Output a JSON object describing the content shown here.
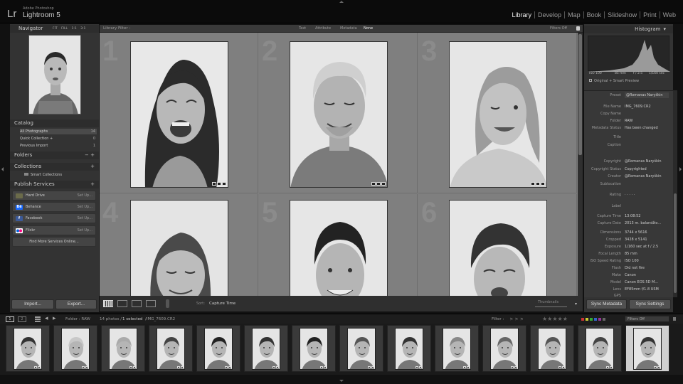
{
  "app": {
    "vendor": "Adobe Photoshop",
    "title": "Lightroom 5",
    "logo": "Lr"
  },
  "modules": [
    {
      "label": "Library",
      "active": true
    },
    {
      "label": "Develop"
    },
    {
      "label": "Map"
    },
    {
      "label": "Book"
    },
    {
      "label": "Slideshow"
    },
    {
      "label": "Print"
    },
    {
      "label": "Web"
    }
  ],
  "left": {
    "navigator": {
      "title": "Navigator",
      "zoom": [
        "FIT",
        "FILL",
        "1:1",
        "3:1"
      ]
    },
    "catalog": {
      "title": "Catalog",
      "items": [
        {
          "label": "All Photographs",
          "count": "14"
        },
        {
          "label": "Quick Collection +",
          "count": "0"
        },
        {
          "label": "Previous Import",
          "count": "1"
        }
      ]
    },
    "folders": {
      "title": "Folders"
    },
    "collections": {
      "title": "Collections",
      "items": [
        "Smart Collections"
      ]
    },
    "publish": {
      "title": "Publish Services",
      "items": [
        {
          "label": "Hard Drive",
          "action": "Set Up...",
          "color": "#6b6b4a"
        },
        {
          "label": "Behance",
          "action": "Set Up...",
          "color": "#1769ff",
          "icon_text": "Bē"
        },
        {
          "label": "Facebook",
          "action": "Set Up...",
          "color": "#3b5998",
          "icon_text": "f"
        },
        {
          "label": "Flickr",
          "action": "Set Up...",
          "color": "#ffffff"
        }
      ],
      "find_more": "Find More Services Online..."
    },
    "import_label": "Import...",
    "export_label": "Export..."
  },
  "filter_bar": {
    "title": "Library Filter :",
    "options": [
      "Text",
      "Attribute",
      "Metadata",
      "None"
    ],
    "active": "None",
    "status": "Filters Off"
  },
  "grid": {
    "cells": [
      "1",
      "2",
      "3",
      "4",
      "5",
      "6"
    ]
  },
  "toolbar": {
    "sort_label": "Sort:",
    "sort_value": "Capture Time",
    "thumbnails_label": "Thumbnails"
  },
  "right": {
    "histogram": {
      "title": "Histogram",
      "iso": "ISO 100",
      "focal": "85 mm",
      "aperture": "f / 2.5",
      "shutter": "1/160 sec",
      "preview": "Original + Smart Preview"
    },
    "metadata": {
      "preset_label": "Preset",
      "preset_value": "@Romanas Naryškin",
      "rows": [
        {
          "k": "File Name",
          "v": "IMG_7609.CR2"
        },
        {
          "k": "Copy Name",
          "v": ""
        },
        {
          "k": "Folder",
          "v": "RAW"
        },
        {
          "k": "Metadata Status",
          "v": "Has been changed"
        },
        {
          "k": "Title",
          "v": ""
        },
        {
          "k": "Caption",
          "v": ""
        },
        {
          "k": "Copyright",
          "v": "@Romanas Naryškin"
        },
        {
          "k": "Copyright Status",
          "v": "Copyrighted"
        },
        {
          "k": "Creator",
          "v": "@Romanas Naryškin"
        },
        {
          "k": "Sublocation",
          "v": ""
        },
        {
          "k": "Rating",
          "v": "·  ·  ·  ·  ·"
        },
        {
          "k": "Label",
          "v": ""
        },
        {
          "k": "Capture Time",
          "v": "13:08:52"
        },
        {
          "k": "Capture Date",
          "v": "2013 m. balandžio..."
        },
        {
          "k": "Dimensions",
          "v": "3744 x 5616"
        },
        {
          "k": "Cropped",
          "v": "3428 x 5141"
        },
        {
          "k": "Exposure",
          "v": "1/160 sec at f / 2.5"
        },
        {
          "k": "Focal Length",
          "v": "85 mm"
        },
        {
          "k": "ISO Speed Rating",
          "v": "ISO 100"
        },
        {
          "k": "Flash",
          "v": "Did not fire"
        },
        {
          "k": "Make",
          "v": "Canon"
        },
        {
          "k": "Model",
          "v": "Canon EOS 5D M..."
        },
        {
          "k": "Lens",
          "v": "EF85mm f/1.8 USM"
        },
        {
          "k": "GPS",
          "v": ""
        }
      ]
    },
    "sync_metadata": "Sync Metadata",
    "sync_settings": "Sync Settings"
  },
  "filmstrip_bar": {
    "view1": "1",
    "view2": "2",
    "source": "Folder : RAW",
    "count": "14 photos /",
    "selected": "1 selected",
    "file": "/IMG_7609.CR2",
    "filter_label": "Filter :",
    "filter_value": "Filters Off"
  },
  "filmstrip": {
    "count": 14,
    "selected_index": 13
  }
}
